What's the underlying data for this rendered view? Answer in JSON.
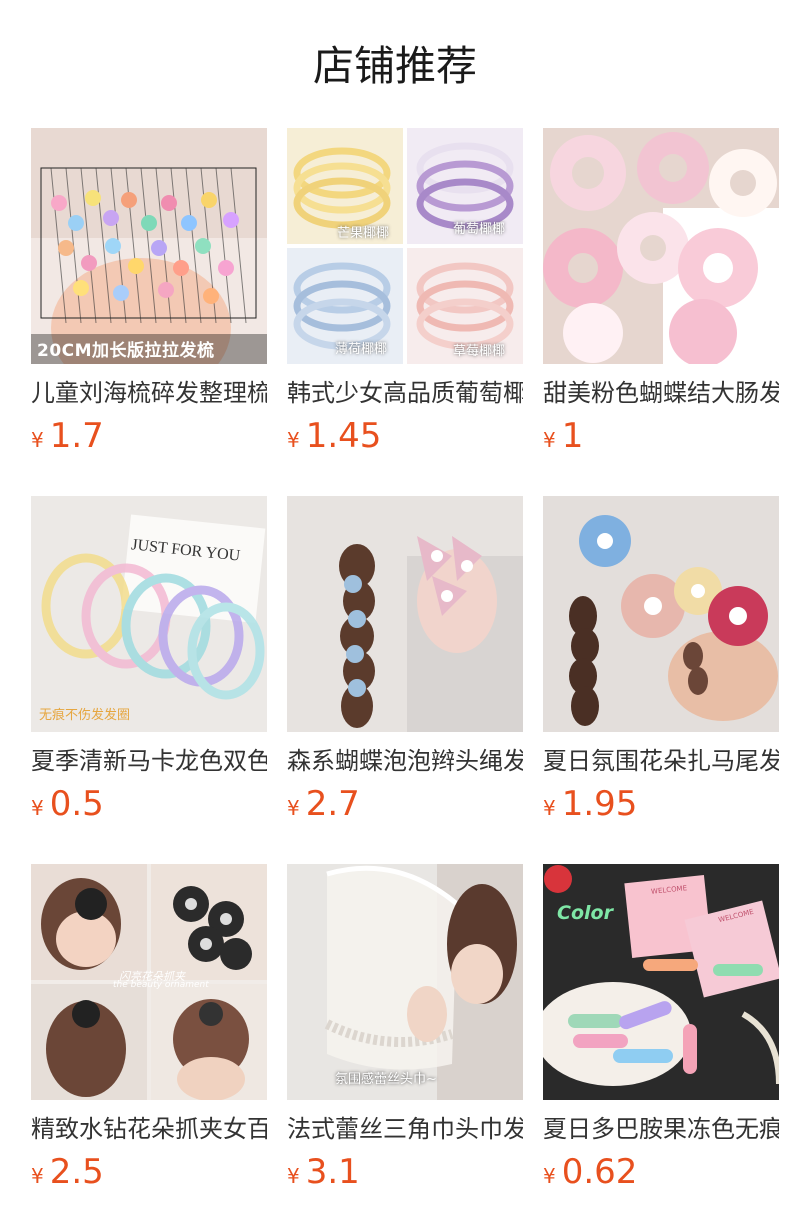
{
  "header": {
    "title": "店铺推荐"
  },
  "currency_symbol": "¥",
  "products": [
    {
      "name": "儿童刘海梳碎发整理梳",
      "price": "1.7",
      "overlay": "20CM加长版拉拉发梳",
      "icon": "hair-comb-image"
    },
    {
      "name": "韩式少女高品质葡萄椰椰",
      "price": "1.45",
      "labels": [
        "芒果椰椰",
        "葡萄椰椰",
        "薄荷椰椰",
        "草莓椰椰"
      ],
      "icon": "coil-hair-ties-image"
    },
    {
      "name": "甜美粉色蝴蝶结大肠发圈",
      "price": "1",
      "icon": "pink-scrunchies-image"
    },
    {
      "name": "夏季清新马卡龙色双色",
      "price": "0.5",
      "card_text": "JUST FOR YOU",
      "overlay": "无痕不伤发发圈",
      "icon": "macaron-hair-ties-image"
    },
    {
      "name": "森系蝴蝶泡泡辫头绳发",
      "price": "2.7",
      "icon": "butterfly-hair-ties-image"
    },
    {
      "name": "夏日氛围花朵扎马尾发",
      "price": "1.95",
      "icon": "flower-hair-ties-image"
    },
    {
      "name": "精致水钻花朵抓夹女百",
      "price": "2.5",
      "overlay": "闪亮花朵抓夹",
      "sub_overlay": "the beauty ornament",
      "icon": "rhinestone-flower-claw-image"
    },
    {
      "name": "法式蕾丝三角巾头巾发",
      "price": "3.1",
      "overlay": "氛围感蕾丝头巾~",
      "icon": "lace-headscarf-image"
    },
    {
      "name": "夏日多巴胺果冻色无痕",
      "price": "0.62",
      "overlay": "Color",
      "card_labels": [
        "WELCOME",
        "WELCOME"
      ],
      "icon": "jelly-hair-clips-image"
    }
  ]
}
